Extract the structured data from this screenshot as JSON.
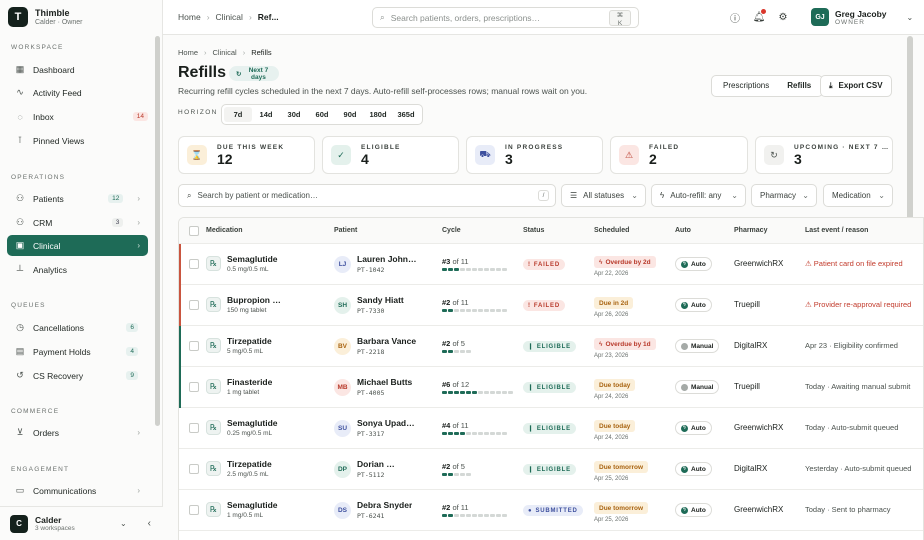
{
  "brand": {
    "name": "Thimble",
    "sub": "Calder · Owner",
    "logo": "T"
  },
  "sidebar": {
    "sections": {
      "workspace": "WORKSPACE",
      "operations": "OPERATIONS",
      "queues": "QUEUES",
      "commerce": "COMMERCE",
      "engagement": "ENGAGEMENT"
    },
    "items": [
      {
        "label": "Dashboard",
        "icon": "grid-icon"
      },
      {
        "label": "Activity Feed",
        "icon": "activity-icon"
      },
      {
        "label": "Inbox",
        "icon": "bell-icon",
        "badge": "14"
      },
      {
        "label": "Pinned Views",
        "icon": "pin-icon"
      },
      {
        "label": "Patients",
        "icon": "users-icon",
        "badge": "12"
      },
      {
        "label": "CRM",
        "icon": "crm-icon",
        "badge": "3"
      },
      {
        "label": "Clinical",
        "icon": "clinical-icon"
      },
      {
        "label": "Analytics",
        "icon": "chart-icon"
      },
      {
        "label": "Cancellations",
        "icon": "clock-icon",
        "badge": "6"
      },
      {
        "label": "Payment Holds",
        "icon": "card-icon",
        "badge": "4"
      },
      {
        "label": "CS Recovery",
        "icon": "recovery-icon",
        "badge": "9"
      },
      {
        "label": "Orders",
        "icon": "cart-icon"
      },
      {
        "label": "Communications",
        "icon": "chat-icon"
      }
    ],
    "workspace": {
      "avatar": "C",
      "name": "Calder",
      "sub": "3 workspaces"
    }
  },
  "topbar": {
    "crumbs": [
      "Home",
      "Clinical",
      "Ref..."
    ],
    "search_placeholder": "Search patients, orders, prescriptions…",
    "kbd": "⌘ K",
    "user": {
      "avatar": "GJ",
      "name": "Greg Jacoby",
      "role": "OWNER"
    }
  },
  "page": {
    "crumbs": [
      "Home",
      "Clinical",
      "Refills"
    ],
    "title": "Refills",
    "pill": "Next 7 days",
    "subtitle": "Recurring refill cycles scheduled in the next 7 days. Auto-refill self-processes rows; manual rows wait on you.",
    "views": [
      "Prescriptions",
      "Refills"
    ],
    "export": "Export CSV",
    "horizon_label": "HORIZON",
    "horizons": [
      "7d",
      "14d",
      "30d",
      "60d",
      "90d",
      "180d",
      "365d"
    ]
  },
  "kpis": [
    {
      "label": "DUE THIS WEEK",
      "value": "12",
      "color": "#fbefd9",
      "fg": "#a86310",
      "icon": "hourglass-icon",
      "glyph": "⌛"
    },
    {
      "label": "ELIGIBLE",
      "value": "4",
      "color": "#e4f1ec",
      "fg": "#1e6b57",
      "icon": "check-circle-icon",
      "glyph": "✓"
    },
    {
      "label": "IN PROGRESS",
      "value": "3",
      "color": "#e8ecf8",
      "fg": "#3d4f9e",
      "icon": "truck-icon",
      "glyph": "⛟"
    },
    {
      "label": "FAILED",
      "value": "2",
      "color": "#fbe6e3",
      "fg": "#b83a2b",
      "icon": "warning-icon",
      "glyph": "⚠"
    },
    {
      "label": "UPCOMING · NEXT 7 …",
      "value": "3",
      "color": "#f1f1ef",
      "fg": "#4b524e",
      "icon": "refresh-icon",
      "glyph": "↻"
    }
  ],
  "filters": {
    "search_placeholder": "Search by patient or medication…",
    "slash": "/",
    "status": "All statuses",
    "auto": "Auto-refill: any",
    "pharmacy": "Pharmacy",
    "medication": "Medication"
  },
  "columns": [
    "Medication",
    "Patient",
    "Cycle",
    "Status",
    "Scheduled",
    "Auto",
    "Pharmacy",
    "Last event / reason"
  ],
  "rows": [
    {
      "med": "Semaglutide",
      "dose": "0.5 mg/0.5 mL",
      "initials": "LJ",
      "av_bg": "#e8ecf8",
      "av_fg": "#3d4f9e",
      "patient": "Lauren Johns…",
      "pid": "PT-1042",
      "cycle": "#3",
      "of": "of 11",
      "filled": 3,
      "total": 11,
      "status": "FAILED",
      "status_cls": "failed",
      "sched": "Overdue by 2d",
      "sched_cls": "red",
      "date": "Apr 22, 2026",
      "auto": "Auto",
      "auto_cls": "",
      "pharmacy": "GreenwichRX",
      "last": "⚠ Patient card on file expired",
      "last_cls": "err",
      "bar": "#c9553f"
    },
    {
      "med": "Bupropion …",
      "dose": "150 mg tablet",
      "initials": "SH",
      "av_bg": "#e4f1ec",
      "av_fg": "#1e6b57",
      "patient": "Sandy Hiatt",
      "pid": "PT-7330",
      "cycle": "#2",
      "of": "of 11",
      "filled": 2,
      "total": 11,
      "status": "FAILED",
      "status_cls": "failed",
      "sched": "Due in 2d",
      "sched_cls": "amb",
      "date": "Apr 26, 2026",
      "auto": "Auto",
      "auto_cls": "",
      "pharmacy": "Truepill",
      "last": "⚠ Provider re-approval required",
      "last_cls": "err",
      "bar": "#c9553f"
    },
    {
      "med": "Tirzepatide",
      "dose": "5 mg/0.5 mL",
      "initials": "BV",
      "av_bg": "#fbefd9",
      "av_fg": "#a86310",
      "patient": "Barbara Vance",
      "pid": "PT-2218",
      "cycle": "#2",
      "of": "of 5",
      "filled": 2,
      "total": 5,
      "status": "ELIGIBLE",
      "status_cls": "eligible",
      "sched": "Overdue by 1d",
      "sched_cls": "red",
      "date": "Apr 23, 2026",
      "auto": "Manual",
      "auto_cls": "m",
      "pharmacy": "DigitalRX",
      "last": "Apr 23 · Eligibility confirmed",
      "last_cls": "",
      "bar": "#1e6b57"
    },
    {
      "med": "Finasteride",
      "dose": "1 mg tablet",
      "initials": "MB",
      "av_bg": "#fbe6e3",
      "av_fg": "#b83a2b",
      "patient": "Michael Butts",
      "pid": "PT-4005",
      "cycle": "#6",
      "of": "of 12",
      "filled": 6,
      "total": 12,
      "status": "ELIGIBLE",
      "status_cls": "eligible",
      "sched": "Due today",
      "sched_cls": "amb",
      "date": "Apr 24, 2026",
      "auto": "Manual",
      "auto_cls": "m",
      "pharmacy": "Truepill",
      "last": "Today · Awaiting manual submit",
      "last_cls": "",
      "bar": "#1e6b57"
    },
    {
      "med": "Semaglutide",
      "dose": "0.25 mg/0.5 mL",
      "initials": "SU",
      "av_bg": "#e8ecf8",
      "av_fg": "#3d4f9e",
      "patient": "Sonya Upadhyay",
      "pid": "PT-3317",
      "cycle": "#4",
      "of": "of 11",
      "filled": 4,
      "total": 11,
      "status": "ELIGIBLE",
      "status_cls": "eligible",
      "sched": "Due today",
      "sched_cls": "amb",
      "date": "Apr 24, 2026",
      "auto": "Auto",
      "auto_cls": "",
      "pharmacy": "GreenwichRX",
      "last": "Today · Auto-submit queued",
      "last_cls": "",
      "bar": ""
    },
    {
      "med": "Tirzepatide",
      "dose": "2.5 mg/0.5 mL",
      "initials": "DP",
      "av_bg": "#e4f1ec",
      "av_fg": "#1e6b57",
      "patient": "Dorian …",
      "pid": "PT-5112",
      "cycle": "#2",
      "of": "of 5",
      "filled": 2,
      "total": 5,
      "status": "ELIGIBLE",
      "status_cls": "eligible",
      "sched": "Due tomorrow",
      "sched_cls": "amb",
      "date": "Apr 25, 2026",
      "auto": "Auto",
      "auto_cls": "",
      "pharmacy": "DigitalRX",
      "last": "Yesterday · Auto-submit queued",
      "last_cls": "",
      "bar": ""
    },
    {
      "med": "Semaglutide",
      "dose": "1 mg/0.5 mL",
      "initials": "DS",
      "av_bg": "#e8ecf8",
      "av_fg": "#3d4f9e",
      "patient": "Debra Snyder",
      "pid": "PT-6241",
      "cycle": "#2",
      "of": "of 11",
      "filled": 2,
      "total": 11,
      "status": "SUBMITTED",
      "status_cls": "submitted",
      "sched": "Due tomorrow",
      "sched_cls": "amb",
      "date": "Apr 25, 2026",
      "auto": "Auto",
      "auto_cls": "",
      "pharmacy": "GreenwichRX",
      "last": "Today · Sent to pharmacy",
      "last_cls": "",
      "bar": ""
    }
  ]
}
